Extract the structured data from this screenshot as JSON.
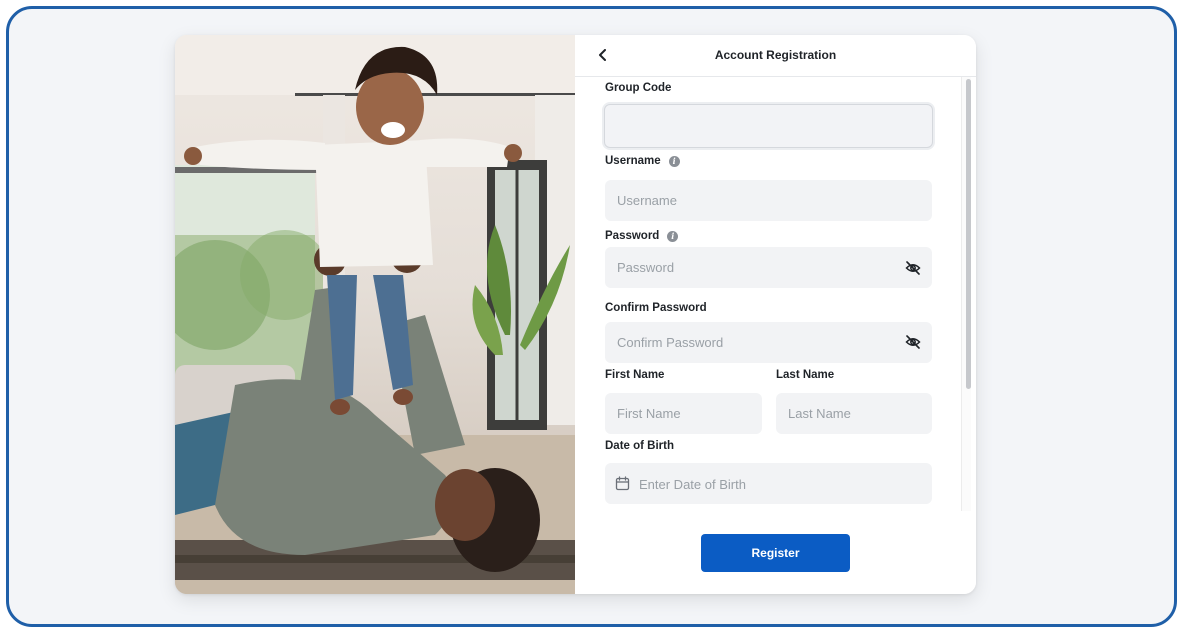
{
  "header": {
    "title": "Account Registration",
    "back_icon": "chevron-left-icon"
  },
  "form": {
    "group_code": {
      "label": "Group Code",
      "value": "",
      "placeholder": ""
    },
    "username": {
      "label": "Username",
      "placeholder": "Username",
      "info_icon": "info-icon"
    },
    "password": {
      "label": "Password",
      "placeholder": "Password",
      "info_icon": "info-icon",
      "toggle_icon": "eye-off-icon"
    },
    "confirm_password": {
      "label": "Confirm Password",
      "placeholder": "Confirm Password",
      "toggle_icon": "eye-off-icon"
    },
    "first_name": {
      "label": "First Name",
      "placeholder": "First Name"
    },
    "last_name": {
      "label": "Last Name",
      "placeholder": "Last Name"
    },
    "date_of_birth": {
      "label": "Date of Birth",
      "placeholder": "Enter Date of Birth",
      "icon": "calendar-icon"
    }
  },
  "actions": {
    "register_label": "Register"
  },
  "colors": {
    "frame_border": "#1f5fa8",
    "primary_button": "#0b5cc4",
    "field_background": "#f2f3f5",
    "page_background": "#f3f5f8"
  }
}
